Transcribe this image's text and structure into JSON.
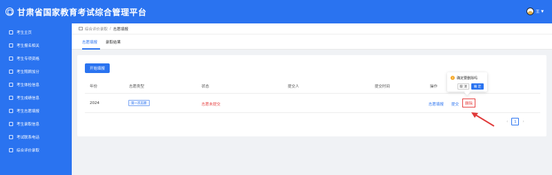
{
  "app": {
    "title": "甘肃省国家教育考试综合管理平台",
    "user_name": "王"
  },
  "sidebar": {
    "items": [
      {
        "label": "考生主页",
        "icon": "user-icon"
      },
      {
        "label": "考生报名相关",
        "icon": "document-icon"
      },
      {
        "label": "考生专项资格",
        "icon": "badge-icon"
      },
      {
        "label": "考生照顾加分",
        "icon": "plus-icon"
      },
      {
        "label": "考生体检信息",
        "icon": "shield-icon"
      },
      {
        "label": "考生成绩信息",
        "icon": "chart-icon"
      },
      {
        "label": "考生志愿填报",
        "icon": "checklist-icon"
      },
      {
        "label": "考生录取信息",
        "icon": "document-icon"
      },
      {
        "label": "考试联系电话",
        "icon": "phone-icon"
      },
      {
        "label": "综合评价录取",
        "icon": "star-icon"
      }
    ]
  },
  "breadcrumb": {
    "parent": "综合评价录取",
    "separator": "/",
    "current": "志愿填报"
  },
  "tabs": [
    {
      "label": "志愿填报"
    },
    {
      "label": "录取结果"
    }
  ],
  "start_button": "开始填报",
  "table": {
    "headers": [
      "年份",
      "志愿类型",
      "状态",
      "提交人",
      "提交时间",
      "操作"
    ],
    "row": {
      "year": "2024",
      "type": "第一次志愿",
      "status": "志愿未提交",
      "submitter": "",
      "submit_time": "",
      "actions": {
        "fill": "志愿填报",
        "submit": "提交",
        "delete": "删除"
      }
    }
  },
  "pagination": {
    "prev": "‹",
    "page": "1",
    "next": "›"
  },
  "popconfirm": {
    "message": "确定要删除吗",
    "cancel": "取 消",
    "ok": "确 定"
  },
  "colors": {
    "primary": "#2a73f0",
    "danger": "#e64040",
    "warning": "#f5a623"
  }
}
